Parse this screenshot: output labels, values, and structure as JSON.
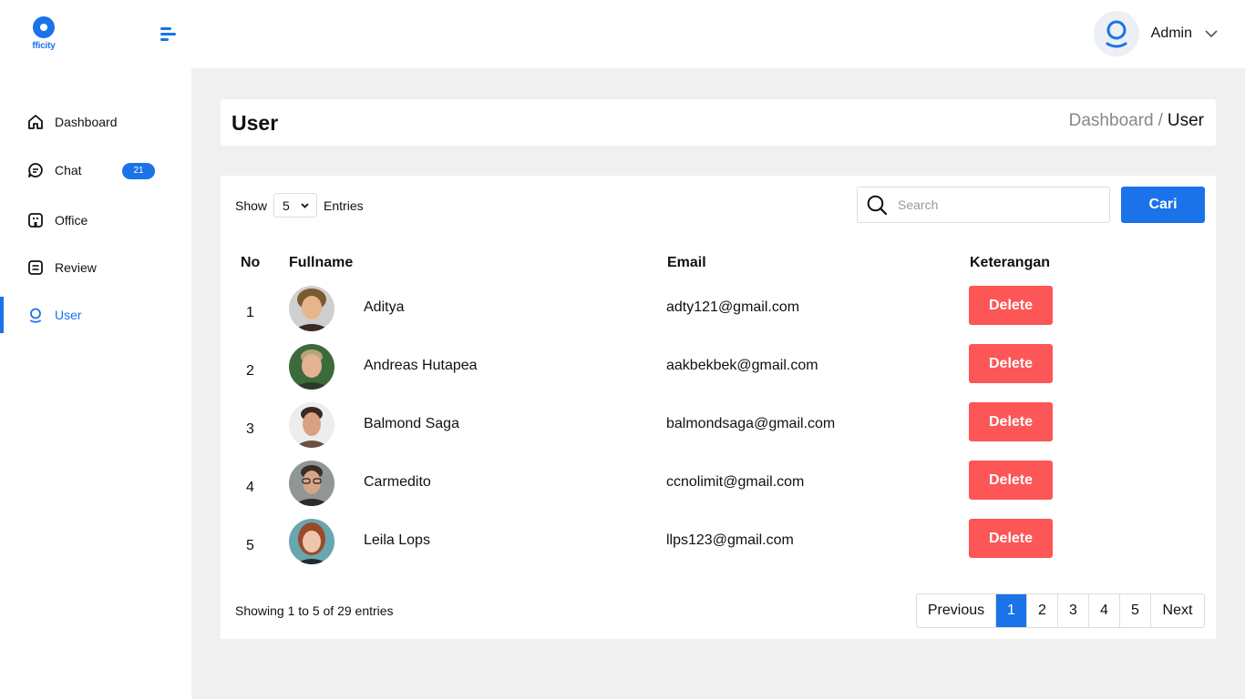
{
  "app": {
    "logo_text": "fficity",
    "brand_color": "#1a73e8"
  },
  "header": {
    "user_name": "Admin"
  },
  "sidebar": {
    "items": [
      {
        "label": "Dashboard",
        "icon": "home-icon"
      },
      {
        "label": "Chat",
        "icon": "chat-icon",
        "badge": "21"
      },
      {
        "label": "Office",
        "icon": "office-icon"
      },
      {
        "label": "Review",
        "icon": "review-icon"
      },
      {
        "label": "User",
        "icon": "user-icon",
        "active": true
      }
    ]
  },
  "page": {
    "title": "User",
    "breadcrumb": {
      "parent": "Dashboard",
      "separator": "/",
      "current": "User"
    }
  },
  "table_controls": {
    "show_label": "Show",
    "entries_value": "5",
    "entries_label": "Entries",
    "search_placeholder": "Search",
    "search_value": "",
    "search_button": "Cari"
  },
  "table": {
    "columns": [
      "No",
      "Fullname",
      "Email",
      "Keterangan"
    ],
    "rows": [
      {
        "no": "1",
        "name": "Aditya",
        "email": "adty121@gmail.com",
        "action": "Delete"
      },
      {
        "no": "2",
        "name": "Andreas Hutapea",
        "email": "aakbekbek@gmail.com",
        "action": "Delete"
      },
      {
        "no": "3",
        "name": "Balmond Saga",
        "email": "balmondsaga@gmail.com",
        "action": "Delete"
      },
      {
        "no": "4",
        "name": "Carmedito",
        "email": "ccnolimit@gmail.com",
        "action": "Delete"
      },
      {
        "no": "5",
        "name": "Leila Lops",
        "email": "llps123@gmail.com",
        "action": "Delete"
      }
    ]
  },
  "footer": {
    "showing_text": "Showing 1 to 5 of 29 entries",
    "pagination": {
      "previous": "Previous",
      "pages": [
        "1",
        "2",
        "3",
        "4",
        "5"
      ],
      "current": "1",
      "next": "Next"
    }
  },
  "colors": {
    "accent": "#1a73e8",
    "danger": "#fc5656",
    "background": "#f0f0f0"
  }
}
